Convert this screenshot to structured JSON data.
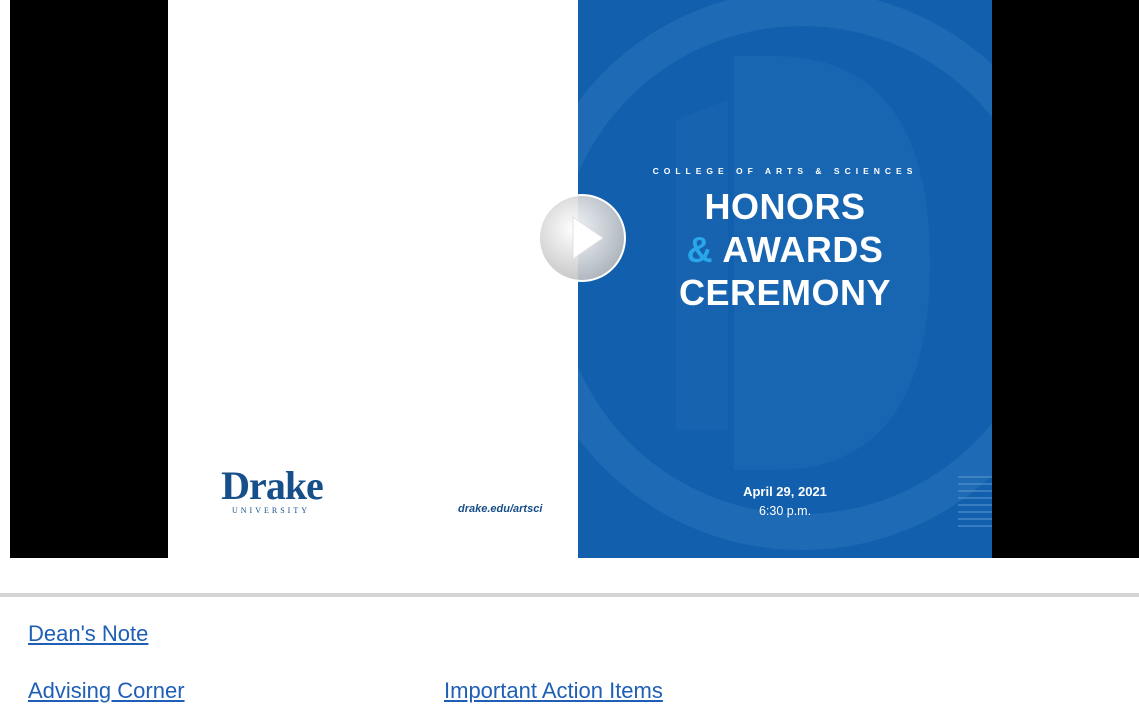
{
  "video": {
    "slide": {
      "college": "COLLEGE OF ARTS & SCIENCES",
      "title_line1": "HONORS",
      "title_amp": "&",
      "title_line2_rest": " AWARDS",
      "title_line3": "CEREMONY",
      "date": "April 29, 2021",
      "time": "6:30 p.m.",
      "logo_name": "Drake",
      "logo_sub": "UNIVERSITY",
      "url": "drake.edu/artsci"
    },
    "play_icon": "play-icon",
    "colors": {
      "slide_blue": "#1260ad",
      "accent_blue": "#2aa7ea",
      "logo_blue": "#174f8a",
      "link": "#1f5fb6"
    }
  },
  "links": {
    "deans_note": "Dean's Note",
    "advising_corner": "Advising Corner",
    "important_action_items": "Important Action Items"
  }
}
